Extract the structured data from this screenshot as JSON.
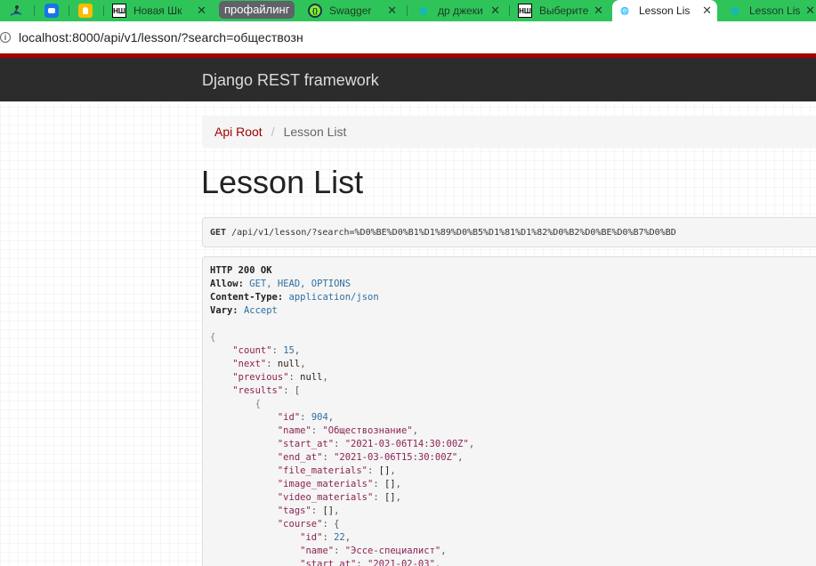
{
  "browser": {
    "tabs": [
      {
        "id": "tab-1",
        "title": "",
        "icon": "surfer-icon"
      },
      {
        "id": "tab-2",
        "title": "",
        "icon": "chat-icon"
      },
      {
        "id": "tab-3",
        "title": "",
        "icon": "keep-icon"
      },
      {
        "id": "tab-4",
        "title": "Новая Шк",
        "icon": "ns-icon"
      },
      {
        "id": "tab-5",
        "title": "Swagger",
        "icon": "swagger-icon"
      },
      {
        "id": "tab-6",
        "title": "др джеки",
        "icon": "globe-icon"
      },
      {
        "id": "tab-7",
        "title": "Выберите",
        "icon": "ns-icon"
      },
      {
        "id": "tab-8",
        "title": "Lesson Lis",
        "icon": "globe-icon",
        "active": true
      },
      {
        "id": "tab-9",
        "title": "Lesson Lis",
        "icon": "globe-icon"
      }
    ],
    "group_label": "профайлинг",
    "ns_badge": "НШ",
    "address": "localhost:8000/api/v1/lesson/?search=обществозн"
  },
  "colors": {
    "tabstrip": "#2fc45a",
    "navbar": "#2c2c2c",
    "navbar_accent": "#a30000",
    "link": "#a30000"
  },
  "drf": {
    "brand": "Django REST framework",
    "breadcrumb": {
      "root": "Api Root",
      "separator": "/",
      "current": "Lesson List"
    },
    "title": "Lesson List",
    "request": {
      "method": "GET",
      "url": "/api/v1/lesson/?search=%D0%BE%D0%B1%D1%89%D0%B5%D1%81%D1%82%D0%B2%D0%BE%D0%B7%D0%BD"
    },
    "response": {
      "status": "HTTP 200 OK",
      "headers": [
        {
          "name": "Allow:",
          "value": "GET, HEAD, OPTIONS"
        },
        {
          "name": "Content-Type:",
          "value": "application/json"
        },
        {
          "name": "Vary:",
          "value": "Accept"
        }
      ],
      "body": {
        "count": "15",
        "next": "null",
        "previous": "null",
        "result_id": "904",
        "result_name": "\"Обществознание\"",
        "start_at": "\"2021-03-06T14:30:00Z\"",
        "end_at": "\"2021-03-06T15:30:00Z\"",
        "empty_list": "[]",
        "course_id": "22",
        "course_name": "\"Эссе-специалист\"",
        "course_start_at": "\"2021-02-03\""
      },
      "keys": {
        "count": "\"count\"",
        "next": "\"next\"",
        "previous": "\"previous\"",
        "results": "\"results\"",
        "id": "\"id\"",
        "name": "\"name\"",
        "start_at": "\"start_at\"",
        "end_at": "\"end_at\"",
        "file_materials": "\"file_materials\"",
        "image_materials": "\"image_materials\"",
        "video_materials": "\"video_materials\"",
        "tags": "\"tags\"",
        "course": "\"course\""
      }
    }
  }
}
